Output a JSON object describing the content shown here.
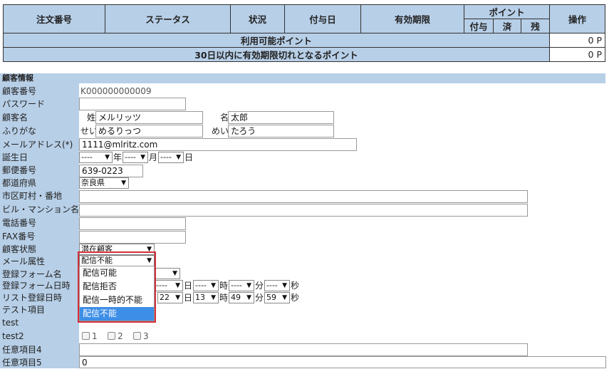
{
  "points_table": {
    "headers": {
      "order_no": "注文番号",
      "status": "ステータス",
      "condition": "状況",
      "grant_date": "付与日",
      "expiry": "有効期限",
      "points": "ポイント",
      "operation": "操作"
    },
    "points_sub": {
      "grant": "付与",
      "used": "済",
      "remaining": "残"
    },
    "available_label": "利用可能ポイント",
    "available_value": "0 P",
    "expiring_label": "30日以内に有効期限切れとなるポイント",
    "expiring_value": "0 P"
  },
  "customer": {
    "section_title": "顧客情報",
    "labels": {
      "customer_no": "顧客番号",
      "password": "パスワード",
      "name": "顧客名",
      "kana": "ふりがな",
      "email": "メールアドレス(*)",
      "birthday": "誕生日",
      "zip": "郵便番号",
      "prefecture": "都道府県",
      "city": "市区町村・番地",
      "building": "ビル・マンション名",
      "phone": "電話番号",
      "fax": "FAX番号",
      "customer_state": "顧客状態",
      "mail_attr": "メール属性",
      "reg_form_name": "登録フォーム名",
      "reg_form_datetime": "登録フォーム日時",
      "list_reg_datetime": "リスト登録日時",
      "test_item": "テスト項目",
      "test": "test",
      "test2": "test2",
      "optional4": "任意項目4",
      "optional5": "任意項目5"
    },
    "values": {
      "customer_no": "K000000000009",
      "last_name_prefix": "姓",
      "last_name": "メルリッツ",
      "first_name_prefix": "名",
      "first_name": "太郎",
      "kana_last_prefix": "せい",
      "kana_last": "めるりっつ",
      "kana_first_prefix": "めい",
      "kana_first": "たろう",
      "email": "1111@mlritz.com",
      "birth_year": "----",
      "year_unit": "年",
      "birth_month": "----",
      "month_unit": "月",
      "birth_day": "----",
      "day_unit": "日",
      "zip": "639-0223",
      "prefecture": "奈良県",
      "customer_state": "潜在顧客",
      "mail_attr": "配信不能",
      "reg_form_day_unit": "日",
      "reg_form_hour": "----",
      "hour_unit": "時",
      "reg_form_min": "----",
      "min_unit": "分",
      "reg_form_sec": "----",
      "sec_unit": "秒",
      "list_day": "22",
      "list_hour": "13",
      "list_min": "49",
      "list_sec": "59",
      "test2_options": [
        "1",
        "2",
        "3"
      ],
      "optional5": "0"
    },
    "mail_attr_options": [
      "配信可能",
      "配信拒否",
      "配信一時的不能",
      "配信不能"
    ]
  },
  "colors": {
    "header_bg": "#b7cfe7",
    "highlight": "#d32f3a",
    "selected_option": "#3d8ee6"
  },
  "icons": {
    "dropdown": "triangle-down-icon"
  }
}
